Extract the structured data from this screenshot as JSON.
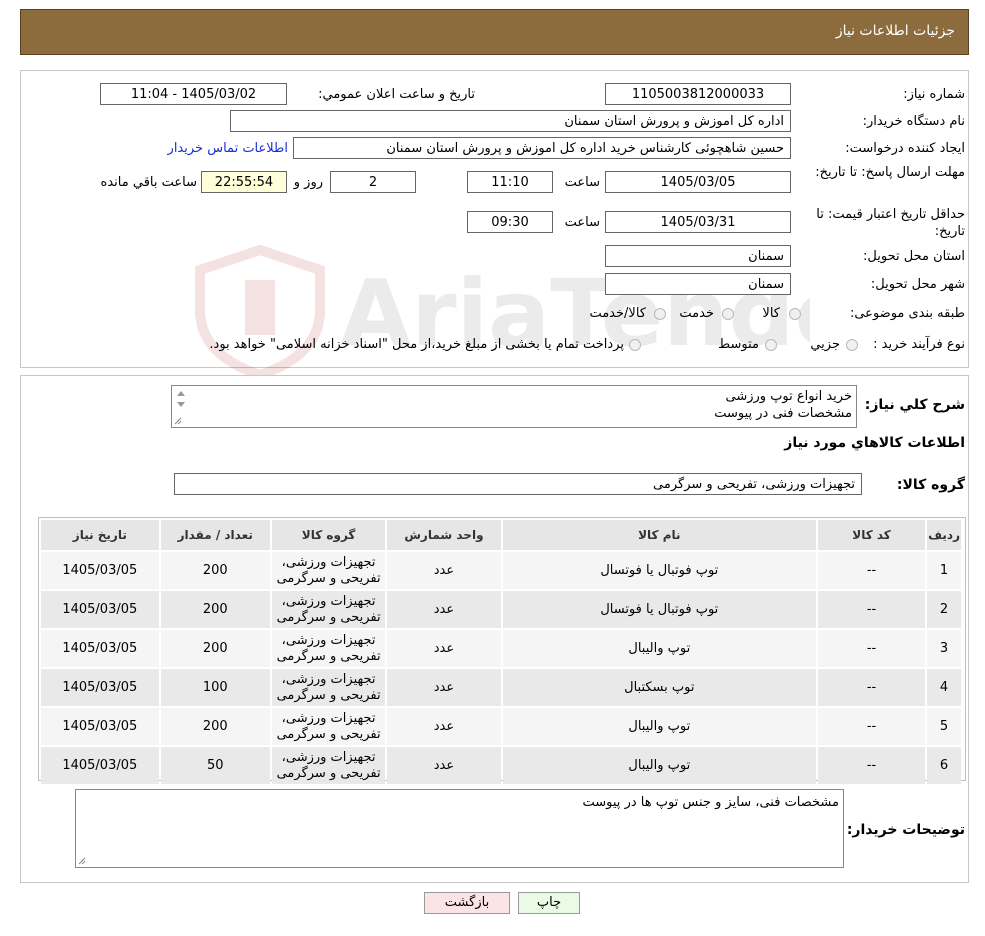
{
  "header": {
    "title": "جزئیات اطلاعات نیاز"
  },
  "info": {
    "need_number_label": "شماره نیاز:",
    "need_number": "1105003812000033",
    "announce_label": "تاريخ و ساعت اعلان عمومي:",
    "announce_value": "1405/03/02 - 11:04",
    "buyer_org_label": "نام دستگاه خريدار:",
    "buyer_org": "اداره کل اموزش و پرورش استان سمنان",
    "creator_label": "ايجاد کننده درخواست:",
    "creator": "حسین شاهچوئی کارشناس خرید اداره کل اموزش و پرورش استان سمنان",
    "contact_link": "اطلاعات تماس خريدار",
    "deadline_label": "مهلت ارسال پاسخ: تا تاريخ:",
    "deadline_date": "1405/03/05",
    "time_label": "ساعت",
    "deadline_time": "11:10",
    "days": "2",
    "days_label": "روز و",
    "remaining": "22:55:54",
    "remaining_label": "ساعت باقي مانده",
    "validity_label": "حداقل تاريخ اعتبار قيمت: تا تاريخ:",
    "validity_date": "1405/03/31",
    "validity_time": "09:30",
    "province_label": "استان محل تحويل:",
    "province": "سمنان",
    "city_label": "شهر محل تحويل:",
    "city": "سمنان",
    "category_label": "طبقه بندی موضوعی:",
    "category_options": [
      "کالا",
      "خدمت",
      "کالا/خدمت"
    ],
    "process_label": "نوع فرآيند خريد :",
    "process_options": [
      "جزيي",
      "متوسط"
    ],
    "process_note": "پرداخت تمام یا بخشی از مبلغ خرید،از محل \"اسناد خزانه اسلامی\" خواهد بود."
  },
  "summary": {
    "description_label": "شرح كلي نياز:",
    "description_lines": [
      "خرید انواع توپ ورزشی",
      "مشخصات فنی در پیوست"
    ],
    "goods_info_title": "اطلاعات كالاهاي مورد نياز",
    "goods_group_label": "گروه كالا:",
    "goods_group": "تجهیزات ورزشی، تفریحی و سرگرمی"
  },
  "table": {
    "headers": [
      "رديف",
      "کد کالا",
      "نام کالا",
      "واحد شمارش",
      "گروه کالا",
      "تعداد / مقدار",
      "تاريخ نياز"
    ],
    "rows": [
      [
        "1",
        "--",
        "توپ فوتبال یا فوتسال",
        "عدد",
        "تجهیزات ورزشی، تفریحی و سرگرمی",
        "200",
        "1405/03/05"
      ],
      [
        "2",
        "--",
        "توپ فوتبال یا فوتسال",
        "عدد",
        "تجهیزات ورزشی، تفریحی و سرگرمی",
        "200",
        "1405/03/05"
      ],
      [
        "3",
        "--",
        "توپ والیبال",
        "عدد",
        "تجهیزات ورزشی، تفریحی و سرگرمی",
        "200",
        "1405/03/05"
      ],
      [
        "4",
        "--",
        "توپ بسکتبال",
        "عدد",
        "تجهیزات ورزشی، تفریحی و سرگرمی",
        "100",
        "1405/03/05"
      ],
      [
        "5",
        "--",
        "توپ والیبال",
        "عدد",
        "تجهیزات ورزشی، تفریحی و سرگرمی",
        "200",
        "1405/03/05"
      ],
      [
        "6",
        "--",
        "توپ والیبال",
        "عدد",
        "تجهیزات ورزشی، تفریحی و سرگرمی",
        "50",
        "1405/03/05"
      ]
    ]
  },
  "buyer_notes": {
    "label": "توضيحات خريدار:",
    "text": "مشخصات فنی، سایز و جنس توپ ها در پیوست"
  },
  "buttons": {
    "print": "چاپ",
    "back": "بازگشت"
  },
  "watermark": {
    "text": "AriaTender.neT"
  },
  "colors": {
    "header_bg": "#8c6b3c",
    "link": "#1a2fd4",
    "remaining_bg": "#ffffd9",
    "back_button_bg": "#fde4e4",
    "print_button_bg": "#e9fbe4"
  }
}
